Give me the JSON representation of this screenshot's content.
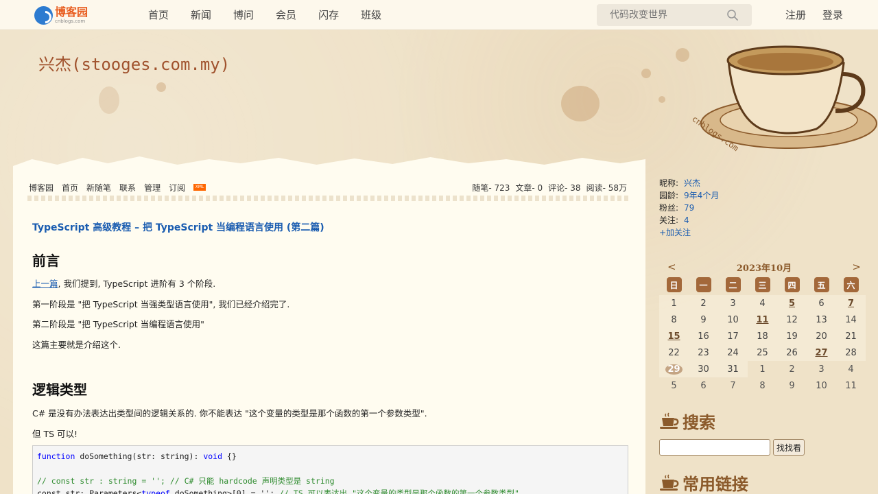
{
  "topnav": {
    "logo_main": "博客园",
    "logo_sub": "cnblogs.com",
    "links": [
      "首页",
      "新闻",
      "博问",
      "会员",
      "闪存",
      "班级"
    ],
    "search_placeholder": "代码改变世界",
    "register": "注册",
    "login": "登录"
  },
  "header": {
    "blog_title": "兴杰(stooges.com.my)",
    "watermark": "cnblogs.com"
  },
  "blognav": {
    "links": [
      "博客园",
      "首页",
      "新随笔",
      "联系",
      "管理",
      "订阅"
    ],
    "xml": "XML",
    "stats": [
      "随笔- 723",
      "文章- 0",
      "评论- 38",
      "阅读- 58万"
    ]
  },
  "post": {
    "title": "TypeScript 高级教程 – 把 TypeScript 当编程语言使用 (第二篇)",
    "h_preface": "前言",
    "p1_link": "上一篇",
    "p1_rest": ", 我们提到, TypeScript 进阶有 3 个阶段.",
    "p2": "第一阶段是 \"把 TypeScript 当强类型语言使用\", 我们已经介绍完了.",
    "p3": "第二阶段是 \"把 TypeScript 当编程语言使用\"",
    "p4": "这篇主要就是介绍这个.",
    "h_logic": "逻辑类型",
    "p5": "C# 是没有办法表达出类型间的逻辑关系的. 你不能表达 \"这个变量的类型是那个函数的第一个参数类型\".",
    "p6": "但 TS 可以!",
    "code": {
      "line1_kw": "function",
      "line1_rest": " doSomething(str: string): ",
      "line1_kw2": "void",
      "line1_end": " {}",
      "line2": "// const str : string = ''; // C# 只能 hardcode 声明类型是 string",
      "line3_a": "const str: Parameters<",
      "line3_kw": "typeof",
      "line3_b": " doSomething>[0] = '';",
      "line3_cm": " // TS 可以表达出 \"这个变量的类型是那个函数的第一个参数类型\""
    }
  },
  "profile": {
    "nickname_label": "昵称:",
    "nickname": "兴杰",
    "age_label": "园龄:",
    "age": "9年4个月",
    "fans_label": "粉丝:",
    "fans": "79",
    "follow_label": "关注:",
    "follow": "4",
    "add_follow": "+加关注"
  },
  "calendar": {
    "prev": "<",
    "next": ">",
    "month": "2023年10月",
    "weekdays": [
      "日",
      "一",
      "二",
      "三",
      "四",
      "五",
      "六"
    ],
    "days": [
      [
        "1",
        "2",
        "3",
        "4",
        "5",
        "6",
        "7"
      ],
      [
        "8",
        "9",
        "10",
        "11",
        "12",
        "13",
        "14"
      ],
      [
        "15",
        "16",
        "17",
        "18",
        "19",
        "20",
        "21"
      ],
      [
        "22",
        "23",
        "24",
        "25",
        "26",
        "27",
        "28"
      ],
      [
        "29",
        "30",
        "31",
        "1",
        "2",
        "3",
        "4"
      ],
      [
        "5",
        "6",
        "7",
        "8",
        "9",
        "10",
        "11"
      ]
    ],
    "linked_days": [
      "5",
      "7",
      "11",
      "15",
      "27"
    ],
    "today": "29"
  },
  "sidebar": {
    "search_heading": "搜索",
    "search_button": "找找看",
    "links_heading": "常用链接"
  },
  "colors": {
    "accent": "#1a5cb0",
    "brown": "#8b5a2b",
    "logo_orange": "#e85d1f"
  }
}
